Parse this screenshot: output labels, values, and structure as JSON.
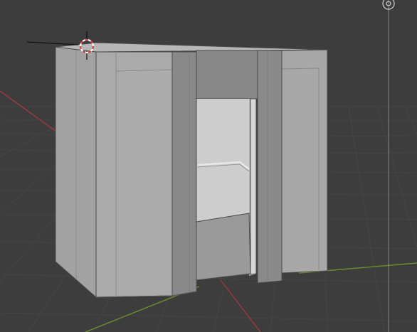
{
  "viewport": {
    "view": "perspective",
    "background_color": "#3d3d3d",
    "grid_color": "#454545",
    "x_axis_color": "#9c3a42",
    "y_axis_color": "#6a8f2f",
    "z_axis_color": "#b9b9b9"
  },
  "scene": {
    "object": "elevator-cabin",
    "shading": "solid",
    "wireframe_color": "#4a4a4a",
    "surface_color": "#a9a9a9"
  },
  "overlays": {
    "cursor_icon": "3d-cursor-icon",
    "origin_gizmo_icon": "scene-origin-icon"
  }
}
